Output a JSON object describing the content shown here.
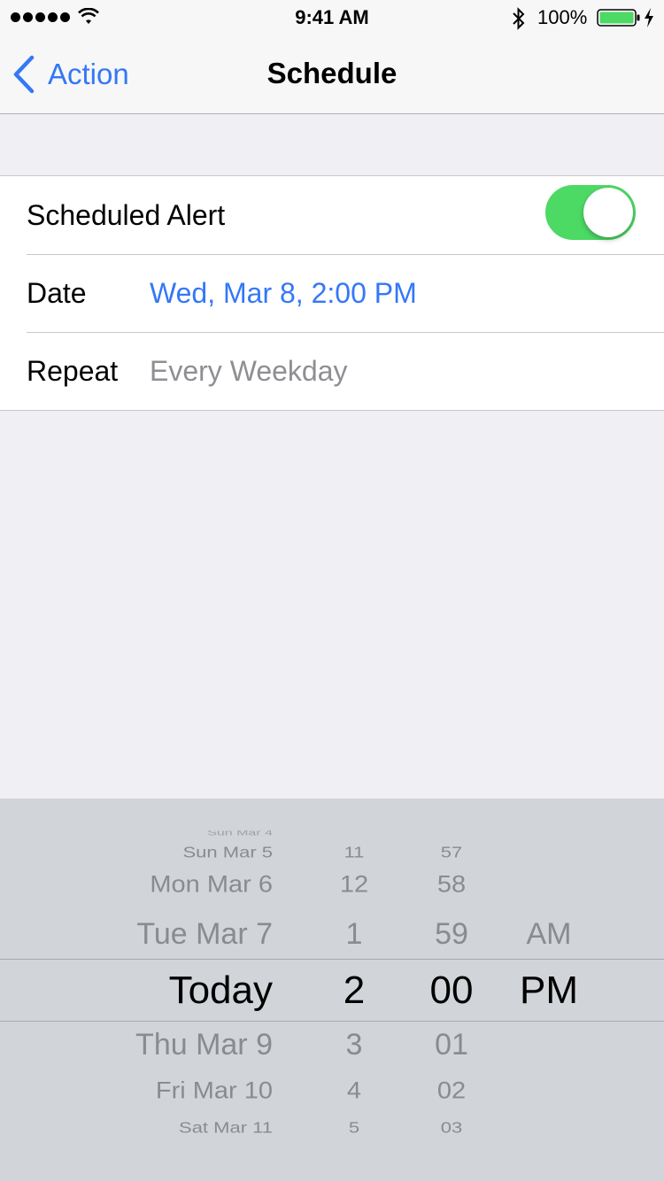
{
  "status_bar": {
    "time": "9:41 AM",
    "battery_percent": "100%",
    "icons": [
      "signal-dots-icon",
      "wifi-icon",
      "bluetooth-icon",
      "battery-icon",
      "charging-bolt-icon"
    ]
  },
  "nav": {
    "back_label": "Action",
    "title": "Schedule"
  },
  "settings": {
    "scheduled_alert_label": "Scheduled Alert",
    "scheduled_alert_on": true,
    "date_label": "Date",
    "date_value": "Wed, Mar 8, 2:00 PM",
    "repeat_label": "Repeat",
    "repeat_value": "Every Weekday"
  },
  "picker": {
    "dates": [
      "Sun Mar 5",
      "Mon Mar 6",
      "Tue Mar 7",
      "Today",
      "Thu Mar 9",
      "Fri Mar 10",
      "Sat Mar 11"
    ],
    "hours": [
      "11",
      "12",
      "1",
      "2",
      "3",
      "4",
      "5"
    ],
    "minutes": [
      "57",
      "58",
      "59",
      "00",
      "01",
      "02",
      "03"
    ],
    "ampm": [
      "AM",
      "PM"
    ],
    "selected": {
      "date": "Today",
      "hour": "2",
      "minute": "00",
      "ampm": "PM"
    }
  },
  "colors": {
    "accent": "#3478f6",
    "toggle_on": "#4cd964",
    "background": "#efeff4",
    "picker_background": "#d1d4d9"
  }
}
